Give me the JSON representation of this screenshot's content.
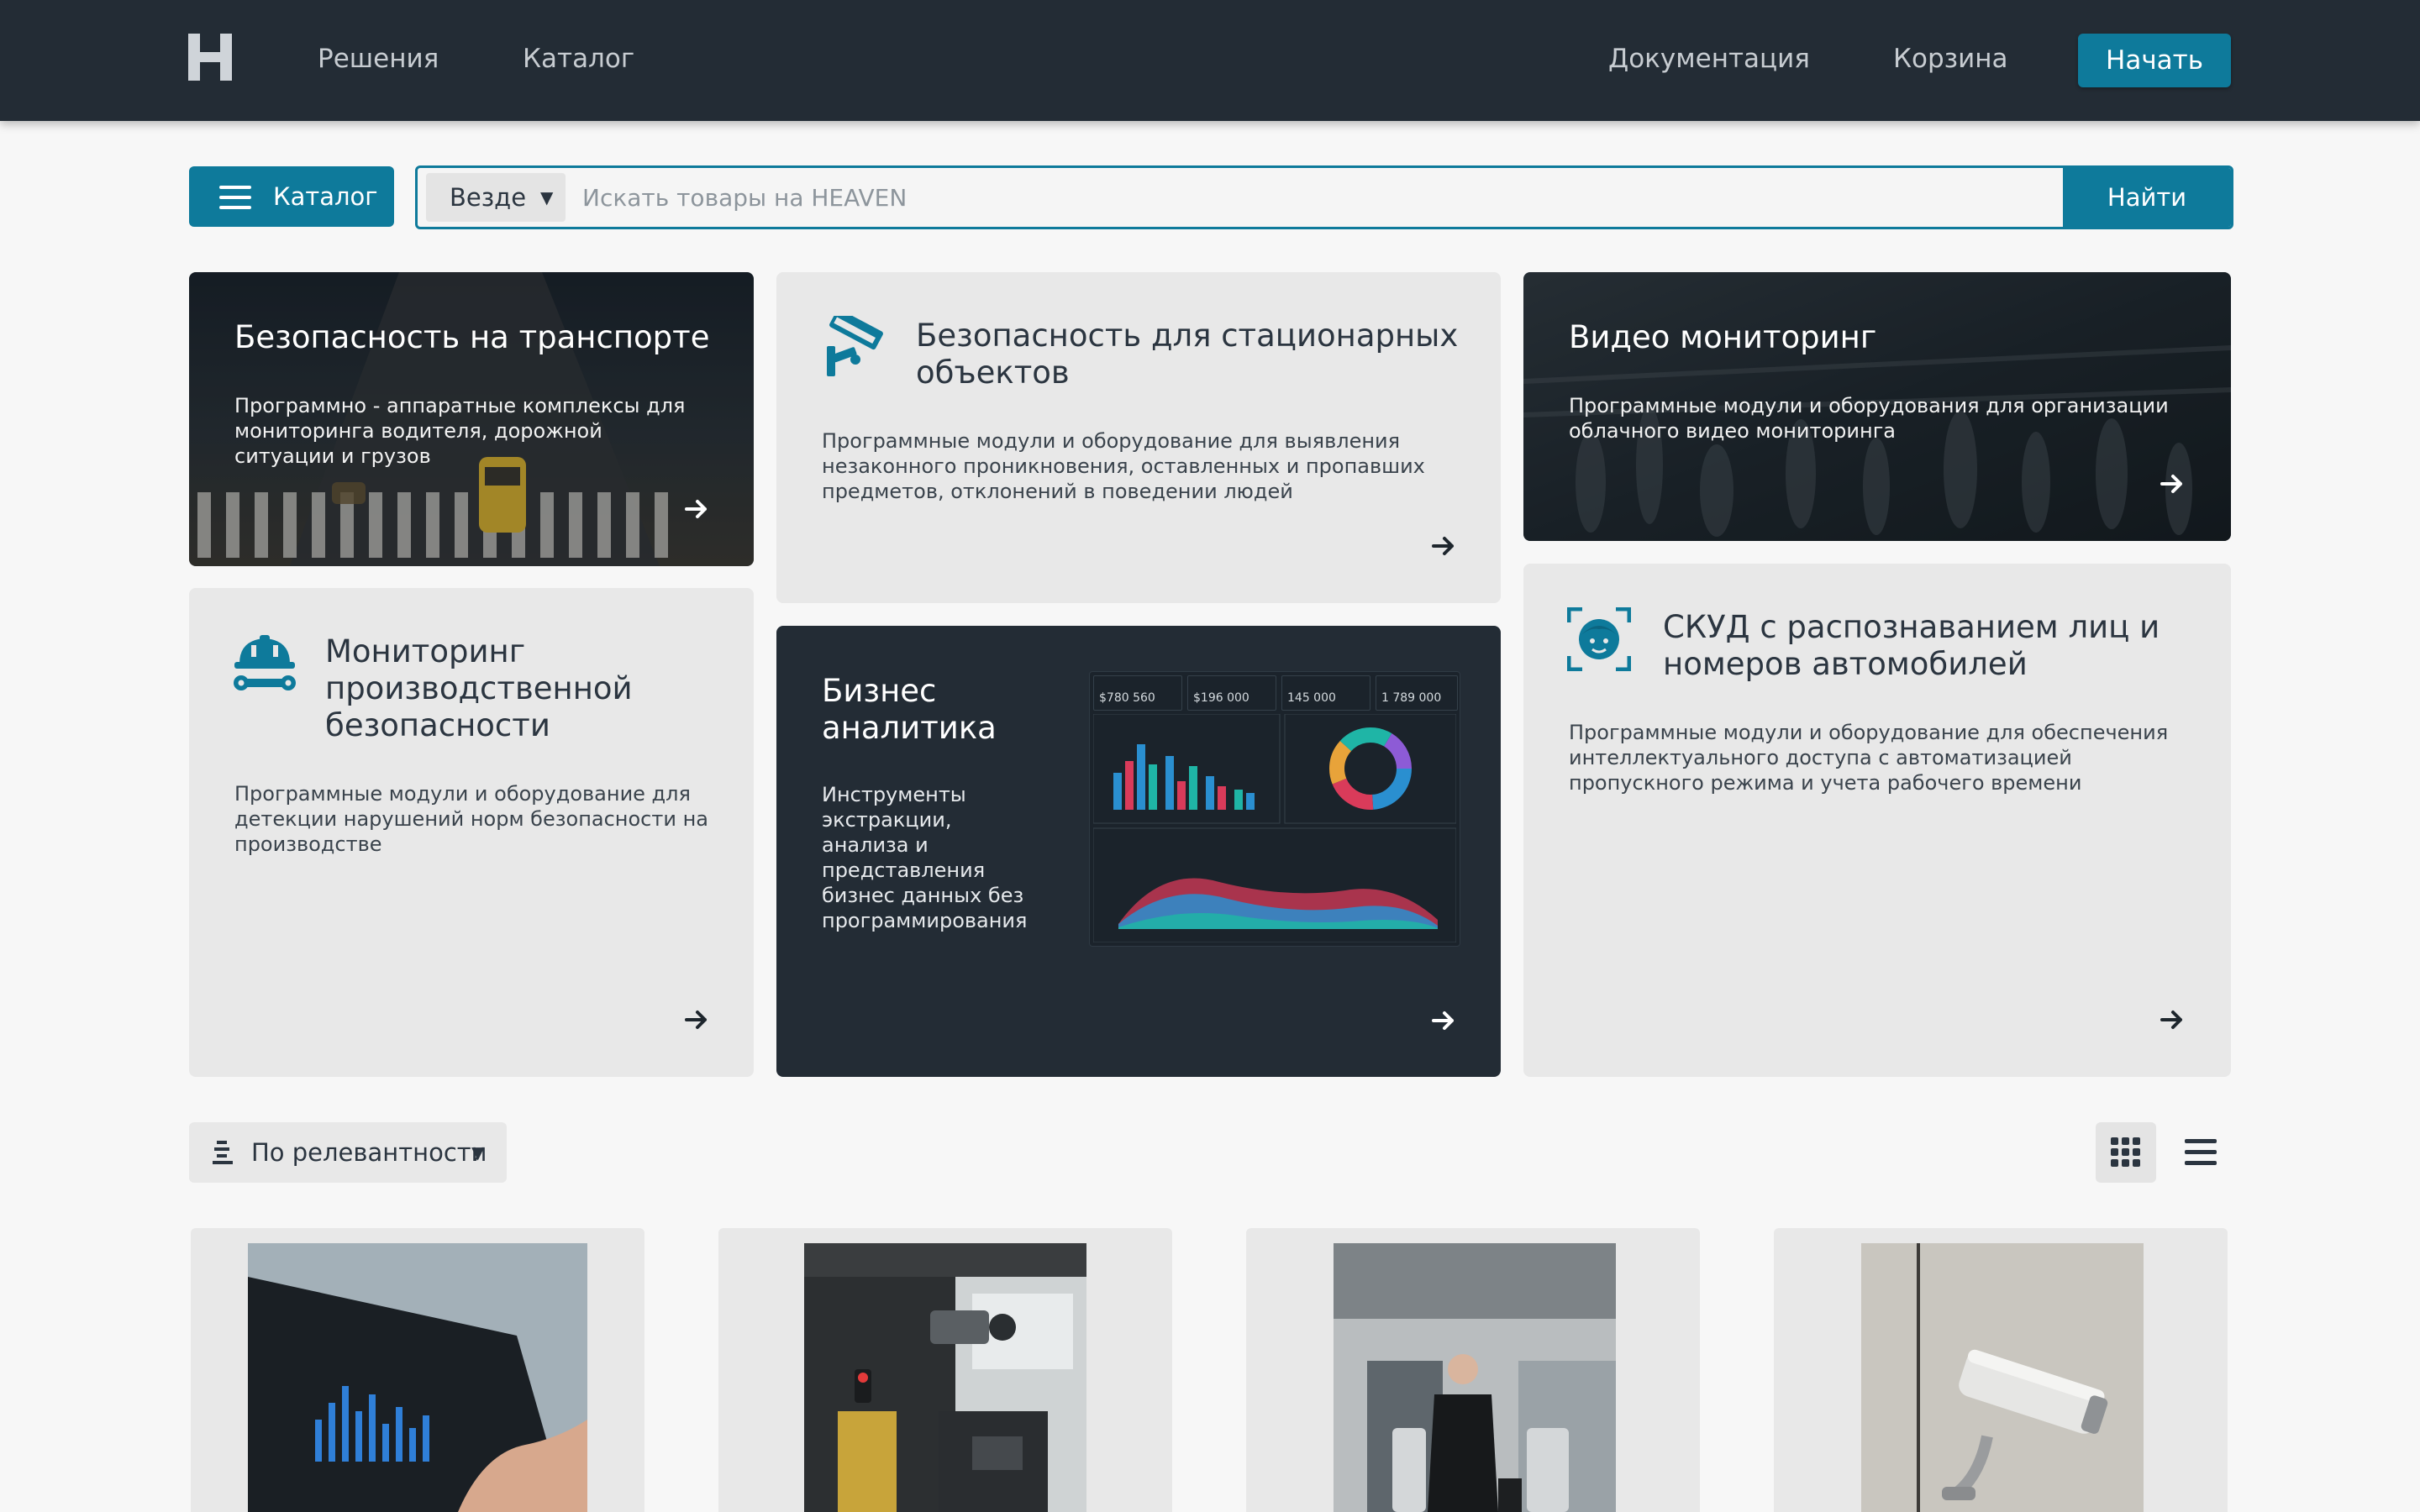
{
  "header": {
    "logo_letter": "H",
    "nav": [
      "Решения",
      "Каталог"
    ],
    "right_nav": [
      "Документация",
      "Корзина"
    ],
    "start_label": "Начать"
  },
  "search": {
    "catalog_label": "Каталог",
    "scope": "Везде",
    "placeholder": "Искать товары на HEAVEN",
    "submit_label": "Найти"
  },
  "cards": {
    "transport": {
      "title": "Безопасность на транспорте",
      "desc": "Программно - аппаратные комплексы для мониторинга водителя, дорожной ситуации и грузов"
    },
    "stationary": {
      "title_line1": "Безопасность для стационарных",
      "title_line2": "объектов",
      "desc": "Программные модули и оборудование для выявления незаконного проникновения, оставленных и пропавших предметов, отклонений в поведении людей"
    },
    "video": {
      "title": "Видео мониторинг",
      "desc": "Программные модули и оборудования для организации облачного видео мониторинга"
    },
    "industrial": {
      "title_line1": "Мониторинг",
      "title_line2": "производственной",
      "title_line3": "безопасности",
      "desc": "Программные модули и оборудование для детекции нарушений норм безопасности на производстве"
    },
    "bi": {
      "title_line1": "Бизнес",
      "title_line2": "аналитика",
      "desc": "Инструменты экстракции, анализа и представления бизнес данных без программирования",
      "kpis": [
        "$780 560",
        "$196 000",
        "145 000",
        "1 789 000"
      ]
    },
    "access": {
      "title_line1": "СКУД с распознаванием лиц и",
      "title_line2": "номеров автомобилей",
      "desc": "Программные модули и оборудование для обеспечения интеллектуального доступа с автоматизацией пропускного режима и учета рабочего времени"
    }
  },
  "sort": {
    "label": "По релевантности"
  },
  "colors": {
    "header_bg": "#232c35",
    "accent": "#0e7a9b",
    "card_light": "#e8e8e8",
    "page_bg": "#f7f7f7"
  },
  "icons": {
    "arrow": "arrow-right-icon",
    "cctv": "cctv-camera-icon",
    "industrial": "hardhat-wrench-icon",
    "face": "face-scan-icon",
    "grid": "grid-view-icon",
    "list": "list-view-icon",
    "sort": "sort-icon",
    "menu": "menu-icon"
  }
}
